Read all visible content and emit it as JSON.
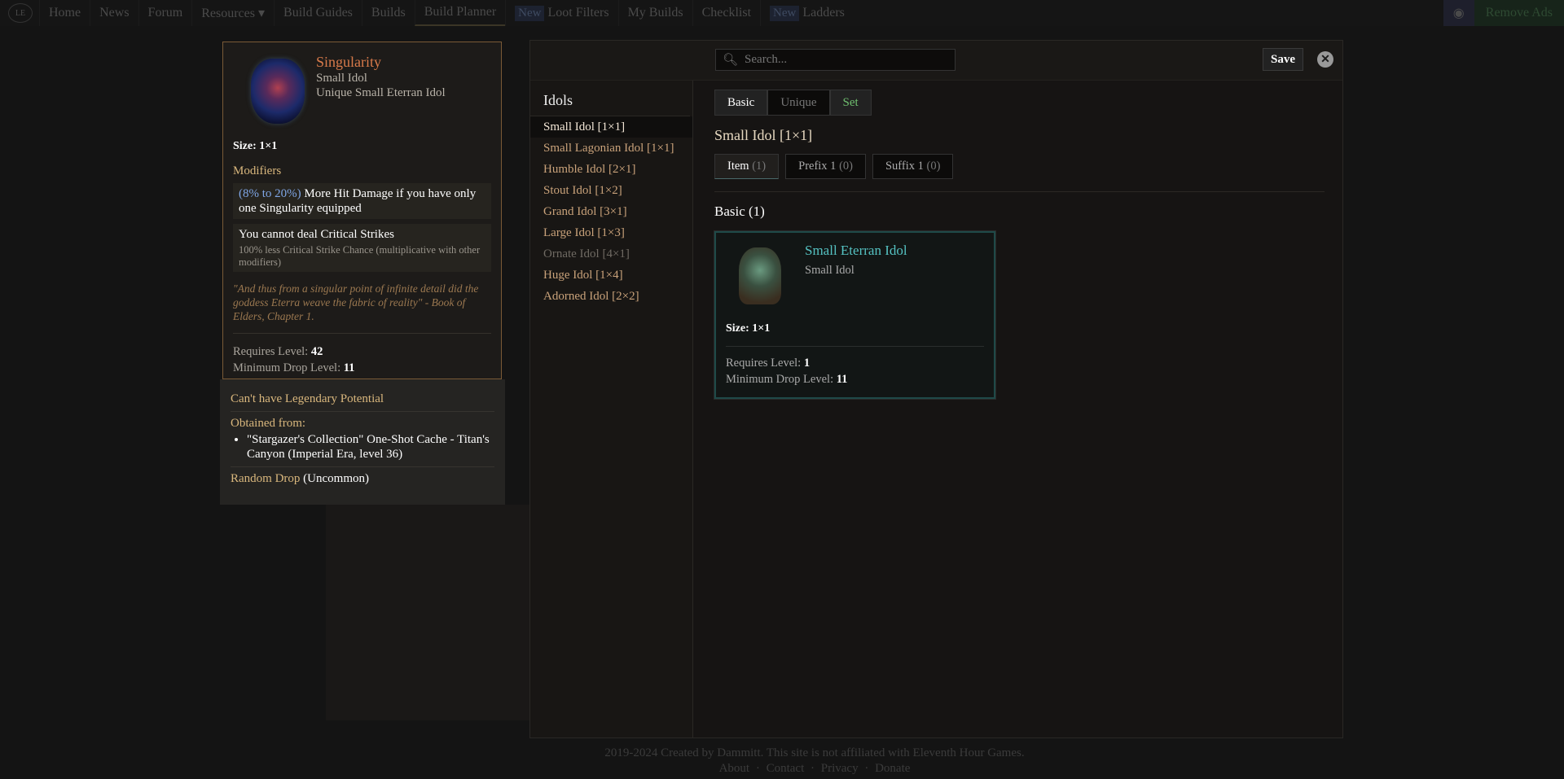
{
  "nav": {
    "logo": "LE",
    "items": [
      "Home",
      "News",
      "Forum",
      "Resources ▾",
      "Build Guides",
      "Builds",
      "Build Planner"
    ],
    "new_badge": "New",
    "items2": [
      "Loot Filters",
      "My Builds",
      "Checklist"
    ],
    "ladders": "Ladders",
    "remove_ads": "Remove Ads"
  },
  "tooltip": {
    "name": "Singularity",
    "type": "Small Idol",
    "subtype": "Unique Small Eterran Idol",
    "size": "Size: 1×1",
    "modifiers_label": "Modifiers",
    "mod1": {
      "range_open": "(",
      "min": "8%",
      "to": " to ",
      "max": "20%",
      "range_close": ")",
      "text": " More Hit Damage if you have only one Singularity equipped"
    },
    "mod2": {
      "text": "You cannot deal Critical Strikes",
      "detail": "100% less Critical Strike Chance (multiplicative with other modifiers)"
    },
    "lore": "\"And thus from a singular point of infinite detail did the goddess Eterra weave the fabric of reality\" - Book of Elders, Chapter 1.",
    "req_label": "Requires Level: ",
    "req": "42",
    "drop_label": "Minimum Drop Level: ",
    "drop": "11"
  },
  "extra": {
    "legendary": "Can't have Legendary Potential",
    "obtained_label": "Obtained from:",
    "source": "\"Stargazer's Collection\" One-Shot Cache - Titan's Canyon (Imperial Era, level 36)",
    "drop_label": "Random Drop",
    "drop_rarity": " (Uncommon)"
  },
  "modal": {
    "search_placeholder": "Search...",
    "save": "Save",
    "close": "✕",
    "sidebar": {
      "title": "Idols",
      "items": [
        {
          "label": "Small Idol [1×1]"
        },
        {
          "label": "Small Lagonian Idol [1×1]"
        },
        {
          "label": "Humble Idol [2×1]"
        },
        {
          "label": "Stout Idol [1×2]"
        },
        {
          "label": "Grand Idol [3×1]"
        },
        {
          "label": "Large Idol [1×3]"
        },
        {
          "label": "Ornate Idol [4×1]"
        },
        {
          "label": "Huge Idol [1×4]"
        },
        {
          "label": "Adorned Idol [2×2]"
        }
      ]
    },
    "tabs": [
      "Basic",
      "Unique",
      "Set"
    ],
    "section_title": "Small Idol [1×1]",
    "item_tabs": [
      {
        "label": "Item",
        "count": "(1)"
      },
      {
        "label": "Prefix 1",
        "count": "(0)"
      },
      {
        "label": "Suffix 1",
        "count": "(0)"
      }
    ],
    "group_title": "Basic (1)",
    "card": {
      "name": "Small Eterran Idol",
      "type": "Small Idol",
      "size": "Size: 1×1",
      "req_label": "Requires Level: ",
      "req": "1",
      "drop_label": "Minimum Drop Level: ",
      "drop": "11"
    }
  },
  "footer": {
    "text": "2019-2024 Created by Dammitt. This site is not affiliated with Eleventh Hour Games.",
    "links": [
      "About",
      "Contact",
      "Privacy",
      "Donate"
    ]
  },
  "colors": {
    "unique": "#d87a4a",
    "gold": "#d9b77d",
    "set": "#6fbf6f",
    "teal": "#55c2c2"
  }
}
